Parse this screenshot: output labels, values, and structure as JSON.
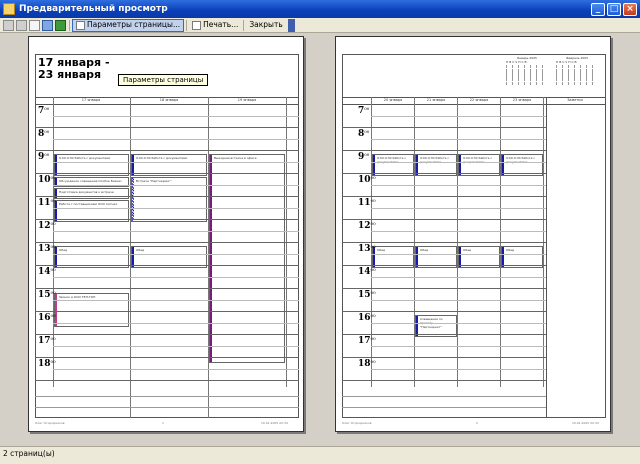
{
  "window": {
    "title": "Предварительный просмотр",
    "minimize": "_",
    "maximize": "□",
    "close": "×"
  },
  "toolbar": {
    "page_setup": "Параметры страницы...",
    "print": "Печать...",
    "close": "Закрыть"
  },
  "popup": {
    "label": "Параметры страницы"
  },
  "page1": {
    "title_line1": "17 января  -",
    "title_line2": "23 января",
    "columns": [
      "17 января",
      "18 января",
      "19 января"
    ],
    "hours": [
      "7",
      "8",
      "9",
      "10",
      "11",
      "12",
      "13",
      "14",
      "15",
      "16",
      "17",
      "18"
    ],
    "hour_suffix": "00",
    "events": [
      "9:00-9:30 Работа с документами",
      "Обсуждение совещания Особое Бизнес",
      "Подготовка документов к встрече",
      "Работа с поставщиками ООО Сигнал",
      "Обед",
      "Звонок в ООО ТЕЛ-ТОН",
      "9:00-9:30 Работа с документами",
      "Встреча \"Партнеринг\"",
      "Обед",
      "Выездная встреча в офисе"
    ],
    "footer_left": "Олег Огородников",
    "footer_center": "1",
    "footer_right": "10.01.2005 22:34"
  },
  "page2": {
    "columns": [
      "20 января",
      "21 января",
      "22 января",
      "23 января",
      "Заметки"
    ],
    "calendar1_title": "Январь 2005",
    "calendar2_title": "Февраль 2005",
    "calendar_days": "П В С Ч П С В",
    "events": [
      "9:00-9:30 Работа с документами",
      "9:00-9:30 Работа с документами",
      "9:00-9:30 Работа с документами",
      "9:00-9:30 Работа с документами",
      "Обед",
      "Обед",
      "Обед",
      "Обед",
      "Совещание по проекту \"Партнеринг\""
    ],
    "footer_left": "Олег Огородников",
    "footer_center": "2",
    "footer_right": "10.01.2005 22:34"
  },
  "status": {
    "pages": "2 страниц(ы)"
  }
}
